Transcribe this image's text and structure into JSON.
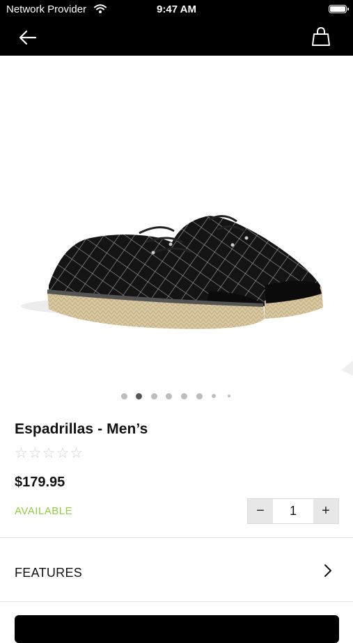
{
  "status_bar": {
    "carrier": "Network Provider",
    "time": "9:47 AM"
  },
  "nav": {
    "back_icon": "arrow-left-icon",
    "bag_icon": "shopping-bag-icon"
  },
  "carousel": {
    "dot_count": 8,
    "active_index": 1
  },
  "product": {
    "name": "Espadrillas - Men’s",
    "rating_stars": "☆☆☆☆☆",
    "price": "$179.95",
    "availability": "AVAILABLE",
    "availability_color": "#8fcf3f"
  },
  "quantity": {
    "minus_label": "−",
    "value": "1",
    "plus_label": "+"
  },
  "features": {
    "label": "FEATURES",
    "chevron_icon": "chevron-right-icon"
  }
}
